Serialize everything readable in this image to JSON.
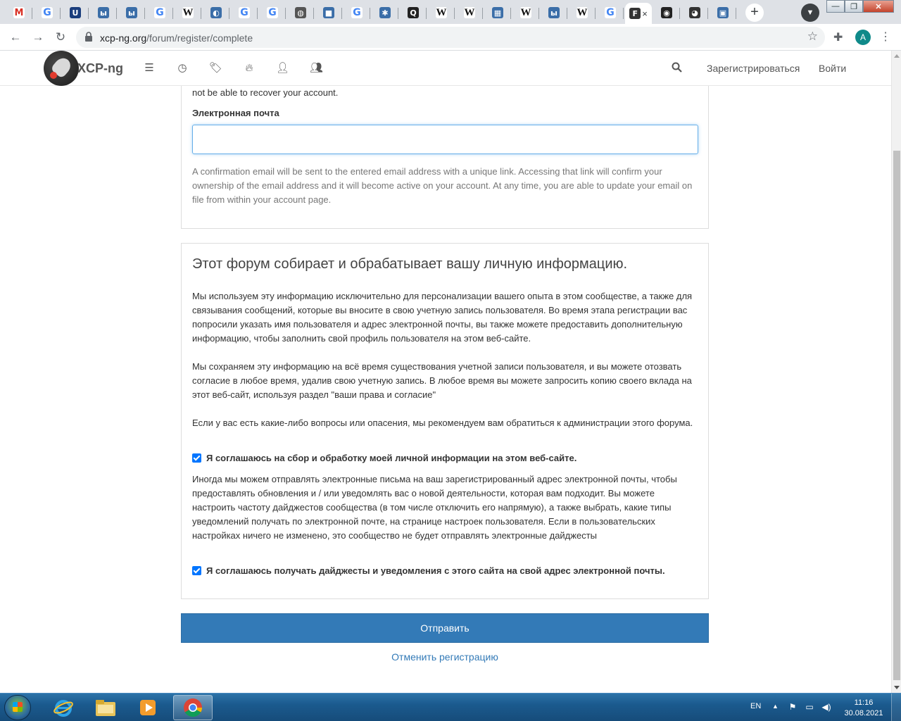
{
  "browser": {
    "tabs": [
      {
        "icon": "gmail-icon",
        "glyph": "M"
      },
      {
        "icon": "google-icon",
        "glyph": "G"
      },
      {
        "icon": "ul-icon",
        "glyph": "U"
      },
      {
        "icon": "site-icon",
        "glyph": "ы"
      },
      {
        "icon": "site-icon",
        "glyph": "ы"
      },
      {
        "icon": "google-icon",
        "glyph": "G"
      },
      {
        "icon": "wikipedia-icon",
        "glyph": "W"
      },
      {
        "icon": "site-icon",
        "glyph": "◐"
      },
      {
        "icon": "google-icon",
        "glyph": "G"
      },
      {
        "icon": "google-icon",
        "glyph": "G"
      },
      {
        "icon": "globe-icon",
        "glyph": "◍"
      },
      {
        "icon": "site-icon",
        "glyph": "■"
      },
      {
        "icon": "google-icon",
        "glyph": "G"
      },
      {
        "icon": "site-icon",
        "glyph": "✱"
      },
      {
        "icon": "quora-icon",
        "glyph": "Q"
      },
      {
        "icon": "wikipedia-icon",
        "glyph": "W"
      },
      {
        "icon": "wikipedia-icon",
        "glyph": "W"
      },
      {
        "icon": "site-icon",
        "glyph": "▦"
      },
      {
        "icon": "wikipedia-icon",
        "glyph": "W"
      },
      {
        "icon": "site-icon",
        "glyph": "ы"
      },
      {
        "icon": "wikipedia-icon",
        "glyph": "W"
      },
      {
        "icon": "google-icon",
        "glyph": "G"
      },
      {
        "icon": "xcp-ng-icon",
        "glyph": "F",
        "active": true
      },
      {
        "icon": "github-icon",
        "glyph": "◉"
      },
      {
        "icon": "xcp-ng-icon",
        "glyph": "◕"
      },
      {
        "icon": "site-icon",
        "glyph": "▣"
      }
    ],
    "url_host": "xcp-ng.org",
    "url_path": "/forum/register/complete",
    "profile_initial": "A",
    "new_tab": "+",
    "active_tab_close": "×"
  },
  "site": {
    "brand": "XCP-ng",
    "nav_icons": [
      "categories-icon",
      "recent-icon",
      "tags-icon",
      "popular-icon",
      "users-icon",
      "groups-icon"
    ],
    "register_label": "Зарегистрироваться",
    "login_label": "Войти"
  },
  "email_panel": {
    "top_text": "not be able to recover your account.",
    "label": "Электронная почта",
    "value": "",
    "help_text": "A confirmation email will be sent to the entered email address with a unique link. Accessing that link will confirm your ownership of the email address and it will become active on your account. At any time, you are able to update your email on file from within your account page."
  },
  "privacy_panel": {
    "title": "Этот форум собирает и обрабатывает вашу личную информацию.",
    "para1": "Мы используем эту информацию исключительно для персонализации вашего опыта в этом сообществе, а также для связывания сообщений, которые вы вносите в свою учетную запись пользователя. Во время этапа регистрации вас попросили указать имя пользователя и адрес электронной почты, вы также можете предоставить дополнительную информацию, чтобы заполнить свой профиль пользователя на этом веб-сайте.",
    "para2": "Мы сохраняем эту информацию на всё время существования учетной записи пользователя, и вы можете отозвать согласие в любое время, удалив свою учетную запись. В любое время вы можете запросить копию своего вклада на этот веб-сайт, используя раздел \"ваши права и согласие\"",
    "para3": "Если у вас есть какие-либо вопросы или опасения, мы рекомендуем вам обратиться к администрации этого форума.",
    "consent_data_label": "Я соглашаюсь на сбор и обработку моей личной информации на этом веб-сайте.",
    "consent_data_checked": true,
    "para4": "Иногда мы можем отправлять электронные письма на ваш зарегистрированный адрес электронной почты, чтобы предоставлять обновления и / или уведомлять вас о новой деятельности, которая вам подходит. Вы можете настроить частоту дайджестов сообщества (в том числе отключить его напрямую), а также выбрать, какие типы уведомлений получать по электронной почте, на странице настроек пользователя. Если в пользовательских настройках ничего не изменено, это сообщество не будет отправлять электронные дайджесты",
    "consent_email_label": "Я соглашаюсь получать дайджесты и уведомления с этого сайта на свой адрес электронной почты.",
    "consent_email_checked": true
  },
  "actions": {
    "submit_label": "Отправить",
    "cancel_label": "Отменить регистрацию"
  },
  "taskbar": {
    "apps": [
      "internet-explorer-icon",
      "file-explorer-icon",
      "media-player-icon",
      "chrome-icon"
    ],
    "active_app": "chrome-icon",
    "language": "EN",
    "time": "11:16",
    "date": "30.08.2021"
  },
  "colors": {
    "accent": "#337ab7",
    "checkbox": "#0075ff",
    "input_focus": "#66afe9"
  }
}
